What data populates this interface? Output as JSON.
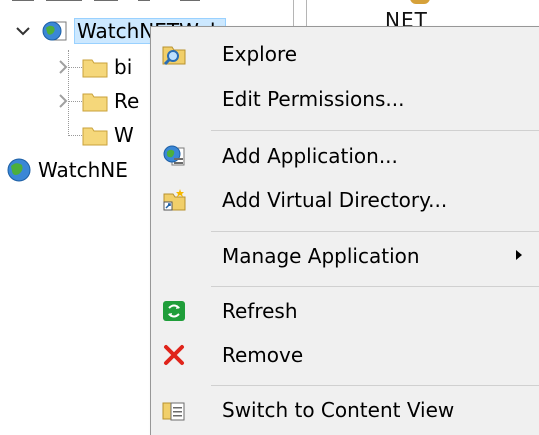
{
  "tree": {
    "site_label": "WatchNETWeb",
    "children": [
      {
        "label": "bi"
      },
      {
        "label": "Re"
      },
      {
        "label": "W"
      }
    ],
    "sibling_label": "WatchNE",
    "right_pane_fragment": "NET"
  },
  "context_menu": {
    "items": [
      {
        "id": "explore",
        "label": "Explore",
        "icon": "explore-folder-icon"
      },
      {
        "id": "edit-permissions",
        "label": "Edit Permissions...",
        "icon": ""
      },
      {
        "id": "add-application",
        "label": "Add Application...",
        "icon": "add-application-icon"
      },
      {
        "id": "add-virtual-directory",
        "label": "Add Virtual Directory...",
        "icon": "add-virtual-directory-icon"
      },
      {
        "id": "manage-application",
        "label": "Manage Application",
        "icon": "",
        "submenu": true
      },
      {
        "id": "refresh",
        "label": "Refresh",
        "icon": "refresh-icon"
      },
      {
        "id": "remove",
        "label": "Remove",
        "icon": "remove-x-icon"
      },
      {
        "id": "switch-content-view",
        "label": "Switch to Content View",
        "icon": "content-view-icon"
      }
    ]
  }
}
